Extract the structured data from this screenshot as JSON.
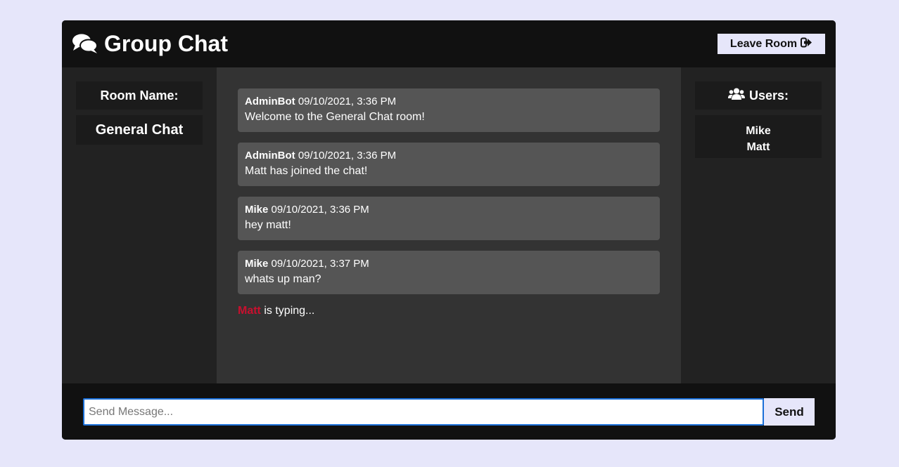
{
  "header": {
    "title": "Group Chat",
    "leave_label": "Leave Room"
  },
  "room": {
    "label": "Room Name:",
    "name": "General Chat"
  },
  "users": {
    "label": "Users:",
    "list": [
      "Mike",
      "Matt"
    ]
  },
  "messages": [
    {
      "user": "AdminBot",
      "time": "09/10/2021, 3:36 PM",
      "text": "Welcome to the General Chat room!"
    },
    {
      "user": "AdminBot",
      "time": "09/10/2021, 3:36 PM",
      "text": "Matt has joined the chat!"
    },
    {
      "user": "Mike",
      "time": "09/10/2021, 3:36 PM",
      "text": "hey matt!"
    },
    {
      "user": "Mike",
      "time": "09/10/2021, 3:37 PM",
      "text": "whats up man?"
    }
  ],
  "typing": {
    "user": "Matt",
    "text": "is typing..."
  },
  "footer": {
    "input_placeholder": "Send Message...",
    "input_value": "",
    "send_label": "Send"
  },
  "icons": {
    "logo": "comments-icon",
    "leave": "sign-out-icon",
    "users": "users-icon"
  },
  "colors": {
    "accent": "#e6e6fa",
    "typing_user": "#c8102e",
    "input_focus": "#1a6fd8"
  }
}
